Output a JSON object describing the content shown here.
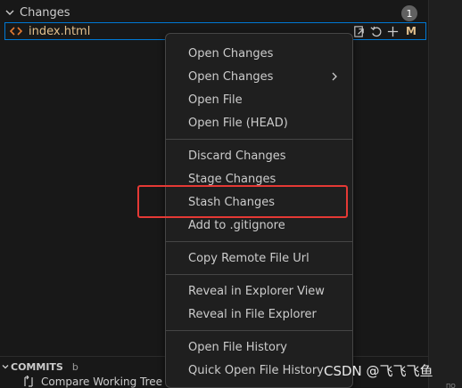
{
  "changes": {
    "title": "Changes",
    "count": "1",
    "file": {
      "name": "index.html",
      "status": "M",
      "icon": "html-code-icon",
      "actions": [
        "open-file-icon",
        "discard-icon",
        "stage-icon"
      ]
    }
  },
  "context_menu": {
    "groups": [
      [
        {
          "label": "Open Changes"
        },
        {
          "label": "Open Changes",
          "has_submenu": true
        },
        {
          "label": "Open File"
        },
        {
          "label": "Open File (HEAD)"
        }
      ],
      [
        {
          "label": "Discard Changes"
        },
        {
          "label": "Stage Changes"
        },
        {
          "label": "Stash Changes",
          "highlighted": true
        },
        {
          "label": "Add to .gitignore"
        }
      ],
      [
        {
          "label": "Copy Remote File Url"
        }
      ],
      [
        {
          "label": "Reveal in Explorer View"
        },
        {
          "label": "Reveal in File Explorer"
        }
      ],
      [
        {
          "label": "Open File History"
        },
        {
          "label": "Quick Open File History"
        }
      ]
    ]
  },
  "commits": {
    "title": "COMMITS",
    "extra": "b",
    "item_text": "Compare Working Tree w"
  },
  "watermark": "CSDN @飞飞飞鱼",
  "corner_text": "ПО",
  "colors": {
    "modified": "#e2c08d",
    "focus_border": "#0078d4",
    "highlight_border": "#e53935",
    "menu_bg": "#1f1f1f",
    "panel_bg": "#181818"
  }
}
